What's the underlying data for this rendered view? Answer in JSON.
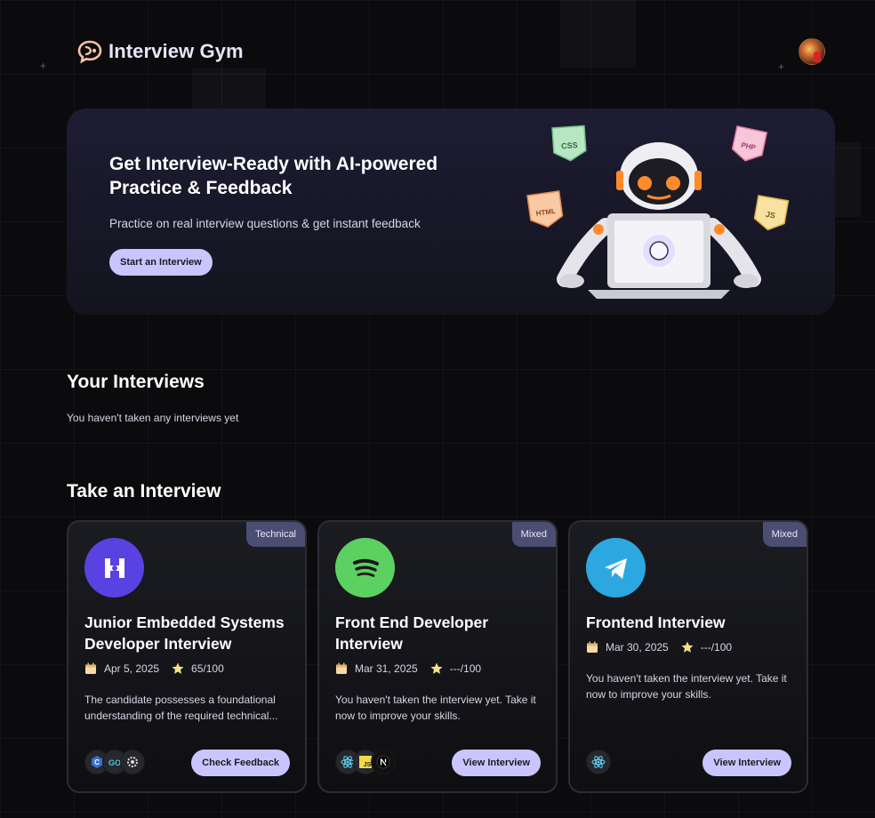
{
  "app": {
    "name": "Interview Gym"
  },
  "hero": {
    "title": "Get Interview-Ready with AI-powered Practice & Feedback",
    "subtitle": "Practice on real interview questions & get instant feedback",
    "cta_label": "Start an Interview",
    "tags": [
      "CSS",
      "PHP",
      "HTML",
      "JS"
    ]
  },
  "your_interviews": {
    "title": "Your Interviews",
    "empty_message": "You haven't taken any interviews yet"
  },
  "take_interview": {
    "title": "Take an Interview",
    "cards": [
      {
        "type": "Technical",
        "logo": "hashnode-logo",
        "logo_color": "#5a41e1",
        "title": "Junior Embedded Systems Developer Interview",
        "date": "Apr 5, 2025",
        "score": "65/100",
        "description": "The candidate possesses a foundational understanding of the required technical...",
        "tech_icons": [
          "c-lang-icon",
          "golang-icon",
          "settings-tech-icon"
        ],
        "button_label": "Check Feedback"
      },
      {
        "type": "Mixed",
        "logo": "spotify-logo",
        "logo_color": "#5dd062",
        "title": "Front End Developer Interview",
        "date": "Mar 31, 2025",
        "score": "---/100",
        "description": "You haven't taken the interview yet. Take it now to improve your skills.",
        "tech_icons": [
          "react-icon",
          "javascript-icon",
          "nextjs-icon"
        ],
        "button_label": "View Interview"
      },
      {
        "type": "Mixed",
        "logo": "telegram-logo",
        "logo_color": "#2ca7e0",
        "title": "Frontend Interview",
        "date": "Mar 30, 2025",
        "score": "---/100",
        "description": "You haven't taken the interview yet. Take it now to improve your skills.",
        "tech_icons": [
          "react-icon"
        ],
        "button_label": "View Interview"
      }
    ]
  },
  "colors": {
    "accent": "#cac5fe",
    "background": "#0b0b0d",
    "badge": "#4b4d73",
    "star": "#f7e08a"
  }
}
